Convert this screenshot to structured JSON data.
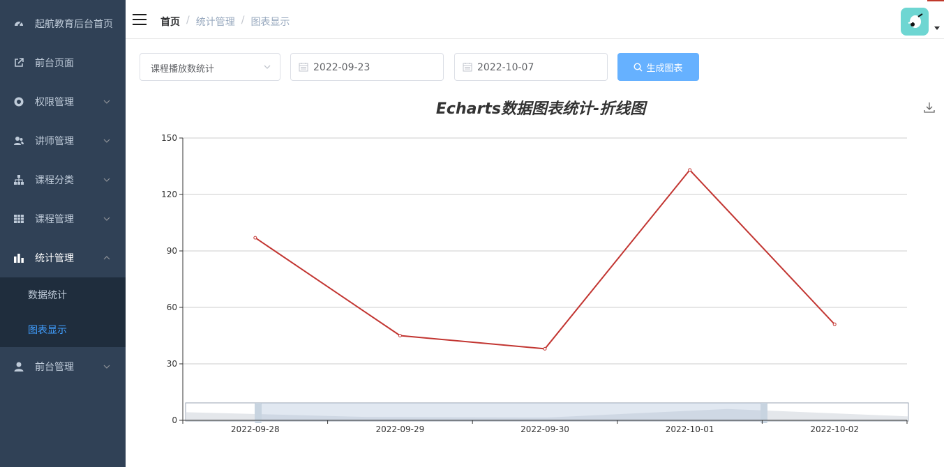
{
  "sidebar": {
    "items": [
      {
        "label": "起航教育后台首页",
        "icon": "dashboard-icon",
        "arrow": false
      },
      {
        "label": "前台页面",
        "icon": "external-link-icon",
        "arrow": false
      },
      {
        "label": "权限管理",
        "icon": "lifebuoy-icon",
        "arrow": true
      },
      {
        "label": "讲师管理",
        "icon": "user-group-icon",
        "arrow": true
      },
      {
        "label": "课程分类",
        "icon": "tree-icon",
        "arrow": true
      },
      {
        "label": "课程管理",
        "icon": "grid-icon",
        "arrow": true
      },
      {
        "label": "统计管理",
        "icon": "bar-chart-icon",
        "arrow": true,
        "expanded": true
      },
      {
        "label": "前台管理",
        "icon": "user-icon",
        "arrow": true
      }
    ],
    "submenu": [
      {
        "label": "数据统计",
        "active": false
      },
      {
        "label": "图表显示",
        "active": true
      }
    ]
  },
  "header": {
    "breadcrumb": [
      "首页",
      "统计管理",
      "图表显示"
    ],
    "separator": "/"
  },
  "form": {
    "select_value": "课程播放数统计",
    "start_date": "2022-09-23",
    "end_date": "2022-10-07",
    "button_label": "生成图表"
  },
  "colors": {
    "sidebar_bg": "#304156",
    "submenu_bg": "#1f2d3d",
    "accent": "#409eff",
    "button": "#66b1ff",
    "line": "#c23531"
  },
  "chart_data": {
    "type": "line",
    "title": "Echarts数据图表统计-折线图",
    "categories": [
      "2022-09-28",
      "2022-09-29",
      "2022-09-30",
      "2022-10-01",
      "2022-10-02"
    ],
    "series": [
      {
        "values": [
          97,
          45,
          38,
          133,
          51
        ]
      }
    ],
    "ylim": [
      0,
      150
    ],
    "yticks": [
      0,
      30,
      60,
      90,
      120,
      150
    ],
    "grid": true,
    "datazoom": true
  }
}
